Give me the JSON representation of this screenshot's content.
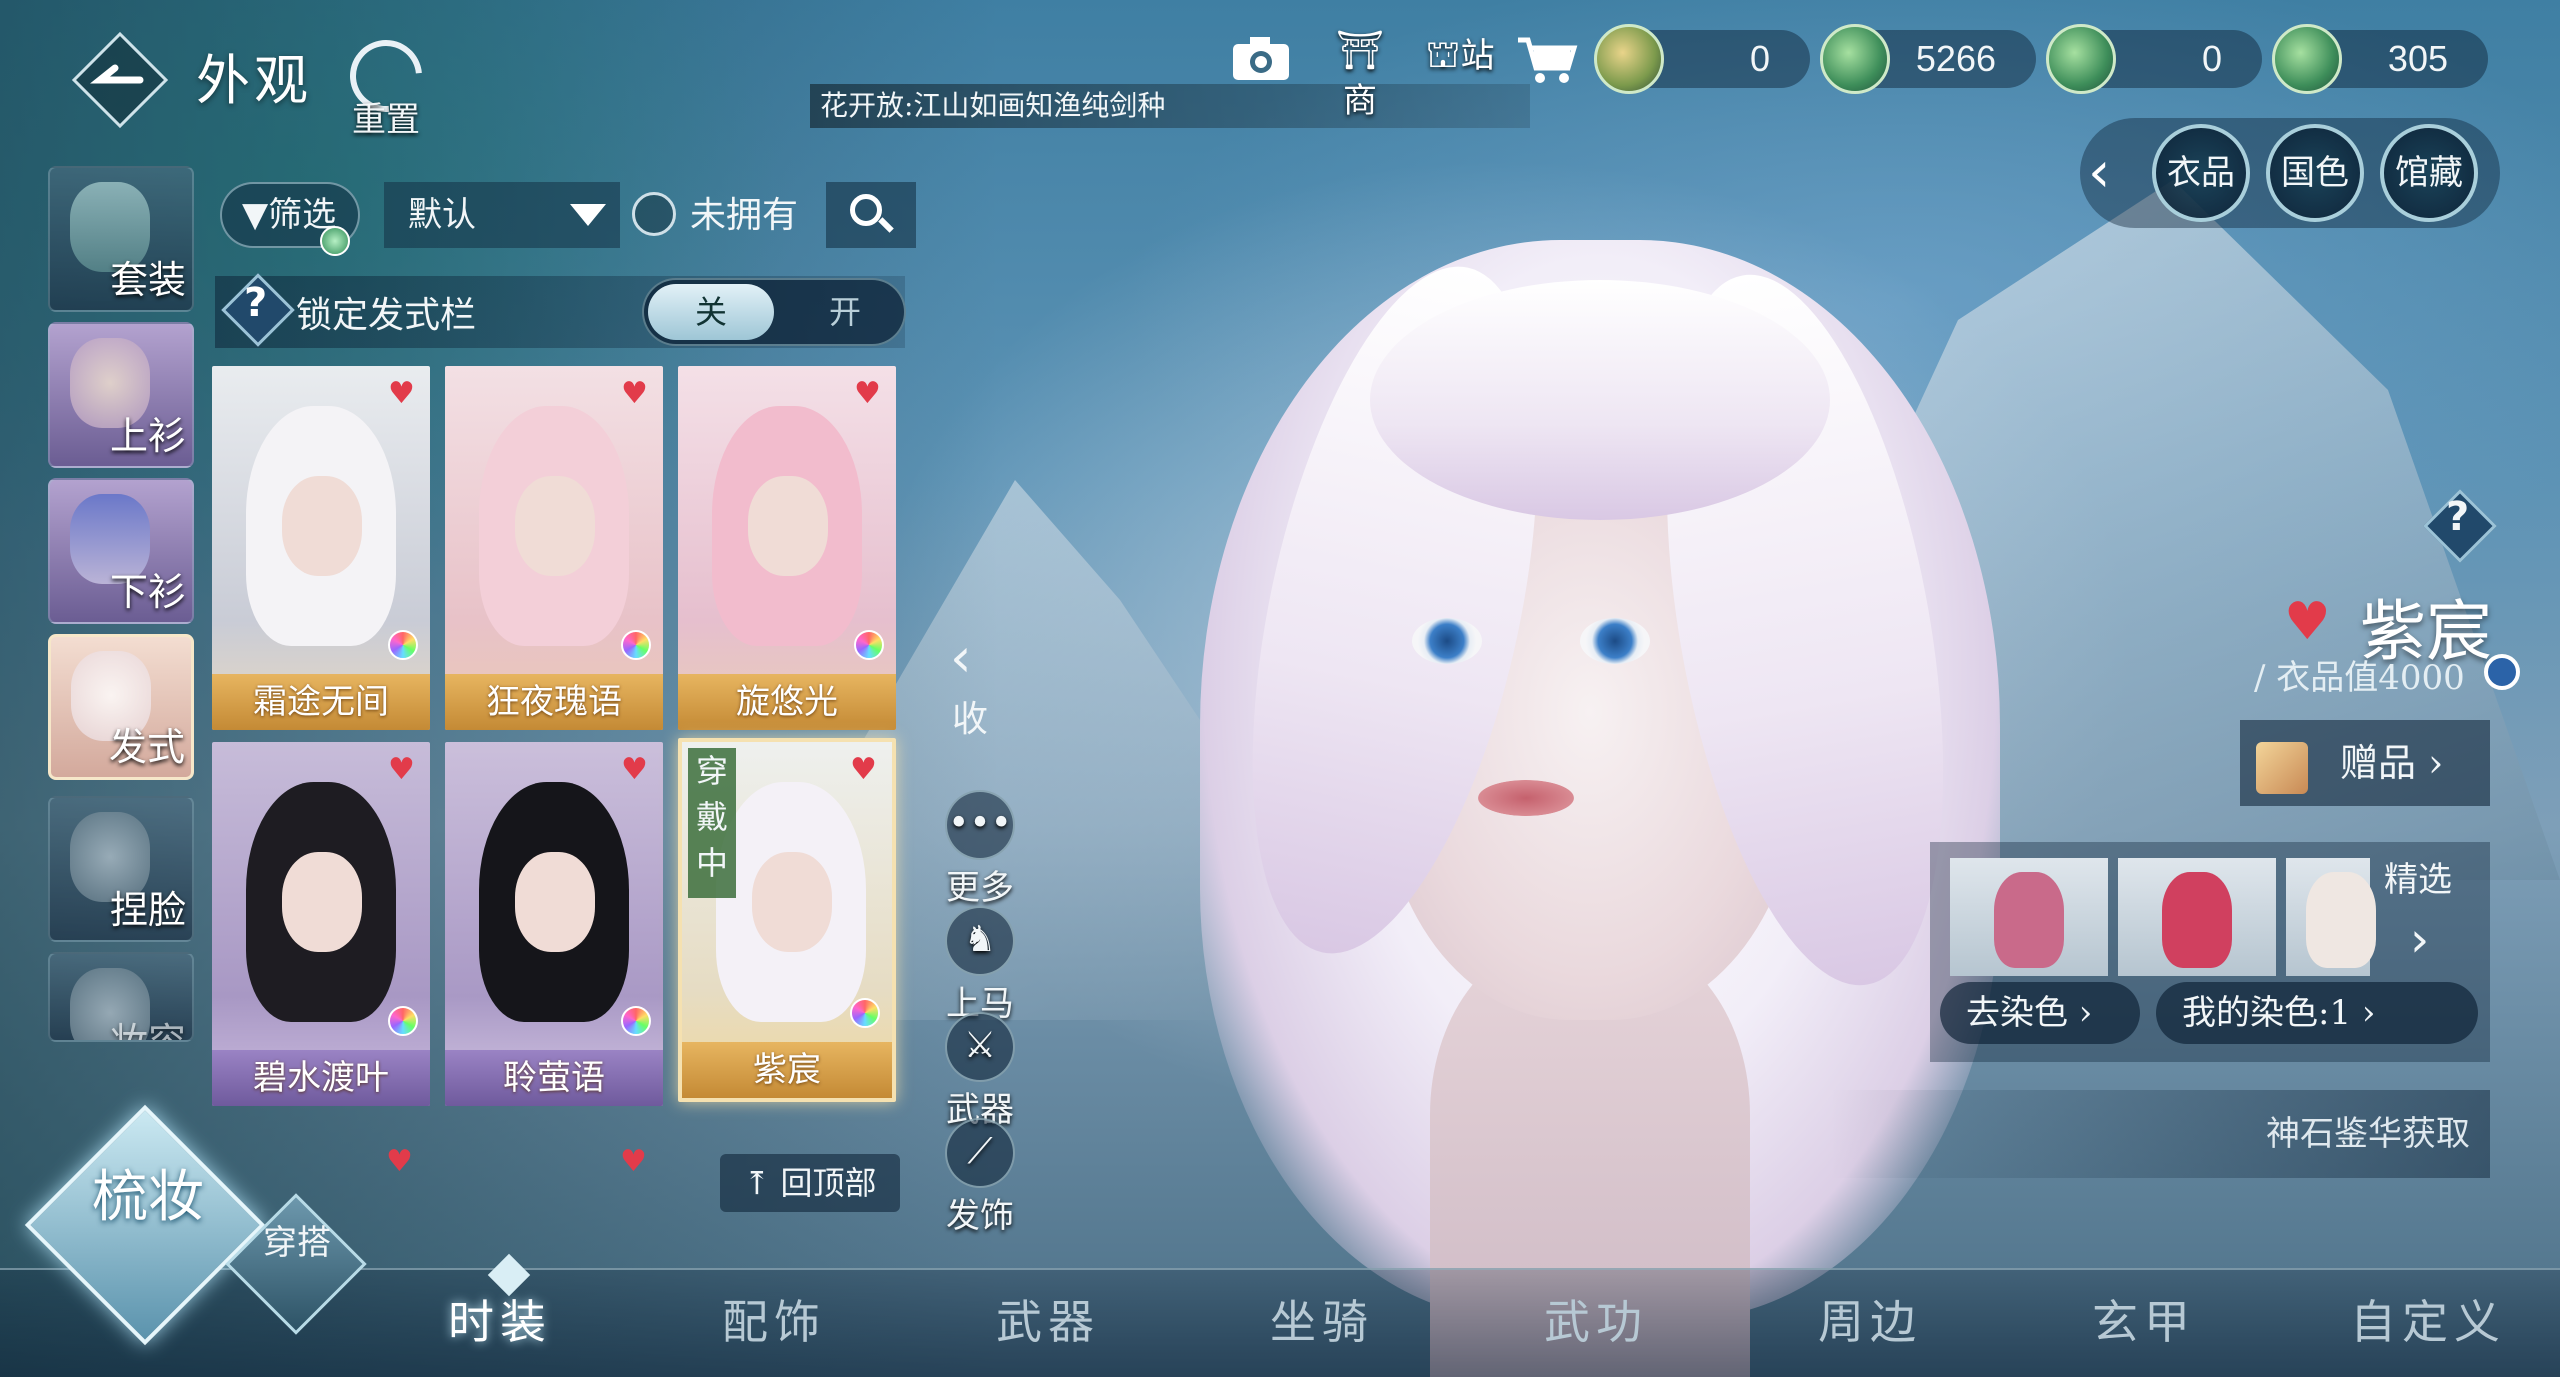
{
  "header": {
    "title": "外观",
    "reset_label": "重置",
    "ticker": "花开放:江山如画知渔纯剑种",
    "icons": [
      {
        "name": "camera-icon",
        "label": ""
      },
      {
        "name": "shop-icon",
        "label": "商"
      },
      {
        "name": "station-icon",
        "label": "站"
      },
      {
        "name": "cart-icon",
        "label": ""
      }
    ],
    "currencies": [
      {
        "name": "jade-coin",
        "value": "0"
      },
      {
        "name": "green-coin-a",
        "value": "5266"
      },
      {
        "name": "green-coin-b",
        "value": "0"
      },
      {
        "name": "green-coin-c",
        "value": "305"
      }
    ]
  },
  "right_nav": {
    "buttons": [
      "衣品",
      "国色",
      "馆藏"
    ]
  },
  "categories": [
    {
      "label": "套装",
      "icon": "robe-icon"
    },
    {
      "label": "上衫",
      "icon": "top-icon"
    },
    {
      "label": "下衫",
      "icon": "shoes-icon"
    },
    {
      "label": "发式",
      "icon": "hairstyle-icon"
    },
    {
      "label": "捏脸",
      "icon": "face-icon"
    },
    {
      "label": "妆容",
      "icon": "makeup-icon"
    }
  ],
  "filter": {
    "filter_label": "筛选",
    "sort_selected": "默认",
    "unowned_label": "未拥有"
  },
  "lock": {
    "label": "锁定发式栏",
    "off_label": "关",
    "on_label": "开"
  },
  "hairstyles": [
    {
      "name": "霜途无间",
      "tag": "gold",
      "hair": "#f4f3f6"
    },
    {
      "name": "狂夜瑰语",
      "tag": "gold",
      "hair": "#f3cfd8"
    },
    {
      "name": "旋悠光",
      "tag": "gold",
      "hair": "#f2bccd"
    },
    {
      "name": "碧水渡叶",
      "tag": "purple",
      "hair": "#1e1c22"
    },
    {
      "name": "聆萤语",
      "tag": "purple",
      "hair": "#15151a"
    },
    {
      "name": "紫宸",
      "tag": "gold",
      "hair": "#f4f1f7",
      "wearing": "穿戴中"
    }
  ],
  "back_to_top": "回顶部",
  "actions": {
    "collapse": "收",
    "more": "更多",
    "mount": "上马",
    "weapon": "武器",
    "accessory": "发饰"
  },
  "item_info": {
    "name": "紫宸",
    "value_label": "/ 衣品值4000",
    "gift_label": "赠品",
    "featured_label": "精选",
    "remove_dye_label": "去染色",
    "my_dye_label": "我的染色:1",
    "acquire_label": "神石鉴华获取"
  },
  "modes": {
    "primary": "梳妆",
    "secondary": "穿搭"
  },
  "bottom_tabs": [
    "时装",
    "配饰",
    "武器",
    "坐骑",
    "武功",
    "周边",
    "玄甲",
    "自定义"
  ],
  "colors": {
    "heart": "#e23b4a",
    "gold_tag": "#d9a24a",
    "purple_tag": "#8a72b6"
  }
}
